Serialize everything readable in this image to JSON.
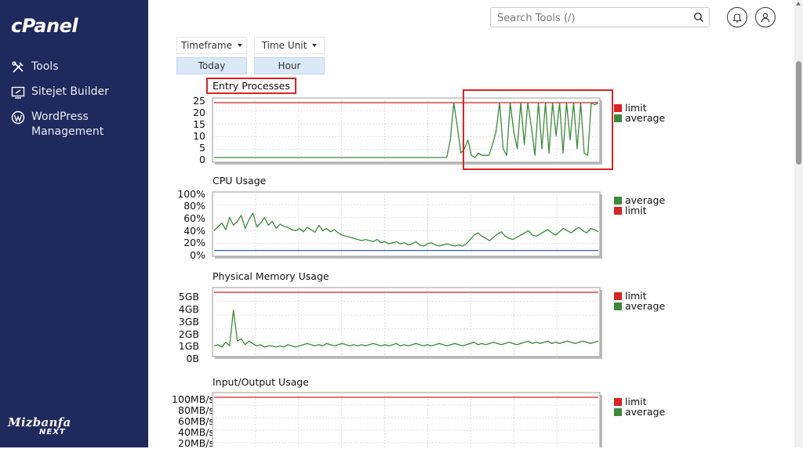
{
  "app": {
    "logo": "cPanel",
    "brand_top": "Mizbanfa",
    "brand_bottom": "NEXT"
  },
  "sidebar": {
    "items": [
      {
        "label": "Tools",
        "icon": "tools-icon"
      },
      {
        "label": "Sitejet Builder",
        "icon": "sitejet-icon"
      },
      {
        "label": "WordPress Management",
        "icon": "wordpress-icon"
      }
    ]
  },
  "header": {
    "search_placeholder": "Search Tools (/)",
    "icons": [
      "search-icon",
      "bell-icon",
      "user-icon"
    ]
  },
  "controls": {
    "timeframe_label": "Timeframe",
    "time_unit_label": "Time Unit",
    "timeframe_value": "Today",
    "time_unit_value": "Hour"
  },
  "colors": {
    "limit": "#dd2222",
    "average": "#3a8a3a",
    "cpu_low": "#3b5cc4",
    "sidebar": "#1f2a5c",
    "highlight": "#dd2222"
  },
  "charts": [
    {
      "title": "Entry Processes",
      "yticks": [
        "25",
        "20",
        "15",
        "10",
        "5",
        "0"
      ],
      "legend": [
        "limit",
        "average"
      ]
    },
    {
      "title": "CPU Usage",
      "yticks": [
        "100%",
        "80%",
        "60%",
        "40%",
        "20%",
        "0%"
      ],
      "legend": [
        "average",
        "limit"
      ]
    },
    {
      "title": "Physical Memory Usage",
      "yticks": [
        "5GB",
        "4GB",
        "3GB",
        "2GB",
        "1GB",
        "0B"
      ],
      "legend": [
        "limit",
        "average"
      ]
    },
    {
      "title": "Input/Output Usage",
      "yticks": [
        "100MB/s",
        "80MB/s",
        "60MB/s",
        "40MB/s",
        "20MB/s"
      ],
      "legend": [
        "limit",
        "average"
      ]
    }
  ],
  "chart_data": [
    {
      "type": "line",
      "title": "Entry Processes",
      "ylim": [
        0,
        25
      ],
      "series": [
        {
          "name": "limit",
          "values": [
            25,
            25,
            25,
            25,
            25,
            25,
            25,
            25,
            25,
            25,
            25,
            25,
            25,
            25,
            25,
            25,
            25,
            25,
            25,
            25,
            25,
            25,
            25,
            25,
            25,
            25,
            25,
            25,
            25,
            25,
            25,
            25,
            25,
            25,
            25,
            25,
            25,
            25,
            25,
            25,
            25,
            25,
            25,
            25,
            25,
            25,
            25,
            25,
            25,
            25,
            25,
            25,
            25,
            25,
            25,
            25,
            25,
            25,
            25,
            25,
            25,
            25,
            25,
            25,
            25,
            25,
            25,
            25,
            25,
            25,
            25,
            25,
            25,
            25,
            25,
            25,
            25,
            25,
            25,
            25,
            25,
            25,
            25,
            25,
            25,
            25,
            25,
            25,
            25,
            25,
            25,
            25,
            25,
            25,
            25,
            25,
            25,
            25,
            25,
            25
          ]
        },
        {
          "name": "average",
          "values": [
            0,
            0,
            0,
            0,
            0,
            0,
            0,
            0,
            0,
            0,
            0,
            0,
            0,
            0,
            0,
            0,
            0,
            0,
            0,
            0,
            0,
            0,
            0,
            0,
            0,
            0,
            0,
            0,
            0,
            0,
            0,
            0,
            0,
            0,
            0,
            0,
            0,
            0,
            0,
            0,
            0,
            0,
            0,
            0,
            0,
            0,
            0,
            0,
            0,
            0,
            0,
            0,
            0,
            0,
            0,
            0,
            0,
            0,
            0,
            0,
            0,
            0,
            0,
            0,
            0,
            0,
            0,
            8,
            25,
            14,
            2,
            4,
            8,
            1,
            0,
            2,
            1,
            1,
            1,
            6,
            12,
            25,
            4,
            1,
            25,
            12,
            4,
            25,
            6,
            25,
            14,
            1,
            25,
            4,
            25,
            2,
            25,
            10,
            25,
            2,
            25,
            8,
            25,
            4,
            25,
            2,
            1,
            25,
            24,
            25
          ]
        }
      ]
    },
    {
      "type": "line",
      "title": "CPU Usage",
      "ylim": [
        0,
        100
      ],
      "series": [
        {
          "name": "average",
          "values": [
            38,
            45,
            52,
            40,
            62,
            48,
            55,
            66,
            42,
            58,
            70,
            45,
            52,
            62,
            48,
            55,
            42,
            50,
            46,
            44,
            40,
            38,
            42,
            36,
            44,
            40,
            35,
            48,
            38,
            42,
            36,
            40,
            34,
            30,
            28,
            26,
            24,
            22,
            20,
            22,
            20,
            18,
            22,
            16,
            18,
            14,
            16,
            18,
            14,
            16,
            12,
            14,
            18,
            12,
            10,
            14,
            16,
            12,
            10,
            12,
            14,
            12,
            10,
            12,
            10,
            14,
            22,
            30,
            34,
            28,
            24,
            20,
            26,
            32,
            36,
            28,
            24,
            22,
            26,
            30,
            34,
            38,
            30,
            28,
            32,
            36,
            40,
            34,
            30,
            36,
            42,
            38,
            34,
            40,
            44,
            38,
            34,
            42,
            40,
            36
          ]
        },
        {
          "name": "limit",
          "values": [
            2,
            2,
            2,
            2,
            2,
            2,
            2,
            2,
            2,
            2,
            2,
            2,
            2,
            2,
            2,
            2,
            2,
            2,
            2,
            2,
            2,
            2,
            2,
            2,
            2,
            2,
            2,
            2,
            2,
            2,
            2,
            2,
            2,
            2,
            2,
            2,
            2,
            2,
            2,
            2,
            2,
            2,
            2,
            2,
            2,
            2,
            2,
            2,
            2,
            2,
            2,
            2,
            2,
            2,
            2,
            2,
            2,
            2,
            2,
            2,
            2,
            2,
            2,
            2,
            2,
            2,
            2,
            2,
            2,
            2,
            2,
            2,
            2,
            2,
            2,
            2,
            2,
            2,
            2,
            2,
            2,
            2,
            2,
            2,
            2,
            2,
            2,
            2,
            2,
            2,
            2,
            2,
            2,
            2,
            2,
            2,
            2,
            2,
            2,
            2
          ]
        }
      ]
    },
    {
      "type": "line",
      "title": "Physical Memory Usage",
      "ylim": [
        0,
        5
      ],
      "series": [
        {
          "name": "limit",
          "values": [
            5,
            5,
            5,
            5,
            5,
            5,
            5,
            5,
            5,
            5,
            5,
            5,
            5,
            5,
            5,
            5,
            5,
            5,
            5,
            5,
            5,
            5,
            5,
            5,
            5,
            5,
            5,
            5,
            5,
            5,
            5,
            5,
            5,
            5,
            5,
            5,
            5,
            5,
            5,
            5,
            5,
            5,
            5,
            5,
            5,
            5,
            5,
            5,
            5,
            5,
            5,
            5,
            5,
            5,
            5,
            5,
            5,
            5,
            5,
            5,
            5,
            5,
            5,
            5,
            5,
            5,
            5,
            5,
            5,
            5,
            5,
            5,
            5,
            5,
            5,
            5,
            5,
            5,
            5,
            5,
            5,
            5,
            5,
            5,
            5,
            5,
            5,
            5,
            5,
            5,
            5,
            5,
            5,
            5,
            5,
            5,
            5,
            5,
            5,
            5
          ]
        },
        {
          "name": "average",
          "values": [
            0.5,
            0.6,
            0.4,
            0.8,
            0.5,
            3.5,
            0.9,
            1.1,
            0.6,
            0.9,
            0.7,
            0.5,
            0.6,
            0.4,
            0.5,
            0.5,
            0.4,
            0.5,
            0.4,
            0.6,
            0.5,
            0.4,
            0.5,
            0.6,
            0.7,
            0.6,
            0.5,
            0.6,
            0.5,
            0.7,
            0.6,
            0.5,
            0.6,
            0.7,
            0.6,
            0.5,
            0.6,
            0.5,
            0.6,
            0.5,
            0.6,
            0.7,
            0.6,
            0.5,
            0.6,
            0.5,
            0.6,
            0.7,
            0.5,
            0.6,
            0.5,
            0.6,
            0.7,
            0.6,
            0.5,
            0.6,
            0.5,
            0.6,
            0.7,
            0.6,
            0.5,
            0.6,
            0.7,
            0.6,
            0.5,
            0.6,
            0.7,
            0.8,
            0.6,
            0.7,
            0.6,
            0.7,
            0.8,
            0.7,
            0.6,
            0.7,
            0.8,
            0.7,
            0.6,
            0.7,
            0.8,
            0.9,
            0.7,
            0.8,
            0.7,
            0.8,
            0.9,
            0.7,
            0.8,
            0.7,
            0.8,
            0.9,
            0.8,
            0.7,
            0.8,
            0.9,
            0.8,
            0.7,
            0.8,
            0.9
          ]
        }
      ]
    },
    {
      "type": "line",
      "title": "Input/Output Usage",
      "ylim": [
        0,
        100
      ],
      "series": [
        {
          "name": "limit",
          "values": [
            100,
            100,
            100,
            100,
            100,
            100,
            100,
            100,
            100,
            100,
            100,
            100,
            100,
            100,
            100,
            100,
            100,
            100,
            100,
            100,
            100,
            100,
            100,
            100,
            100,
            100,
            100,
            100,
            100,
            100,
            100,
            100,
            100,
            100,
            100,
            100,
            100,
            100,
            100,
            100,
            100,
            100,
            100,
            100,
            100,
            100,
            100,
            100,
            100,
            100,
            100,
            100,
            100,
            100,
            100,
            100,
            100,
            100,
            100,
            100,
            100,
            100,
            100,
            100,
            100,
            100,
            100,
            100,
            100,
            100,
            100,
            100,
            100,
            100,
            100,
            100,
            100,
            100,
            100,
            100,
            100,
            100,
            100,
            100,
            100,
            100,
            100,
            100,
            100,
            100,
            100,
            100,
            100,
            100,
            100,
            100,
            100,
            100,
            100,
            100
          ]
        }
      ]
    }
  ]
}
